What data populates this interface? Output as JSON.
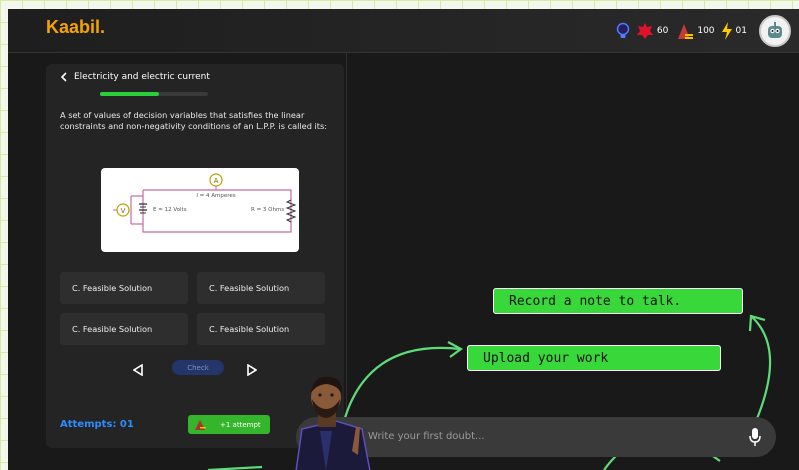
{
  "app": {
    "logo": "Kaabil."
  },
  "header": {
    "stats": [
      {
        "icon": "bulb-icon",
        "value": ""
      },
      {
        "icon": "ruby-icon",
        "value": "60"
      },
      {
        "icon": "coin-stack-icon",
        "value": "100"
      },
      {
        "icon": "lightning-icon",
        "value": "01"
      }
    ]
  },
  "question_panel": {
    "topic": "Electricity and electric current",
    "progress": 0.55,
    "question": "A set of values of decision variables that satisfies the linear constraints and non-negativity conditions of an L.P.P. is called its:",
    "diagram": {
      "current_label": "I = 4 Amperes",
      "voltage_label": "E = 12 Volts",
      "resistance_label": "R = 3 Ohms",
      "ammeter": "A",
      "voltmeter": "V"
    },
    "options": [
      "C. Feasible Solution",
      "C. Feasible Solution",
      "C. Feasible Solution",
      "C. Feasible Solution"
    ],
    "check_label": "Check",
    "attempts_label": "Attempts: 01",
    "extra_attempt_label": "+1 attempt"
  },
  "callouts": {
    "record": "Record a note to talk.",
    "upload": "Upload your work"
  },
  "chat": {
    "placeholder": "Write your first doubt..."
  },
  "colors": {
    "accent_orange": "#f5a300",
    "accent_green": "#38d83a",
    "accent_blue": "#2e8cff",
    "panel_bg": "#242424"
  }
}
